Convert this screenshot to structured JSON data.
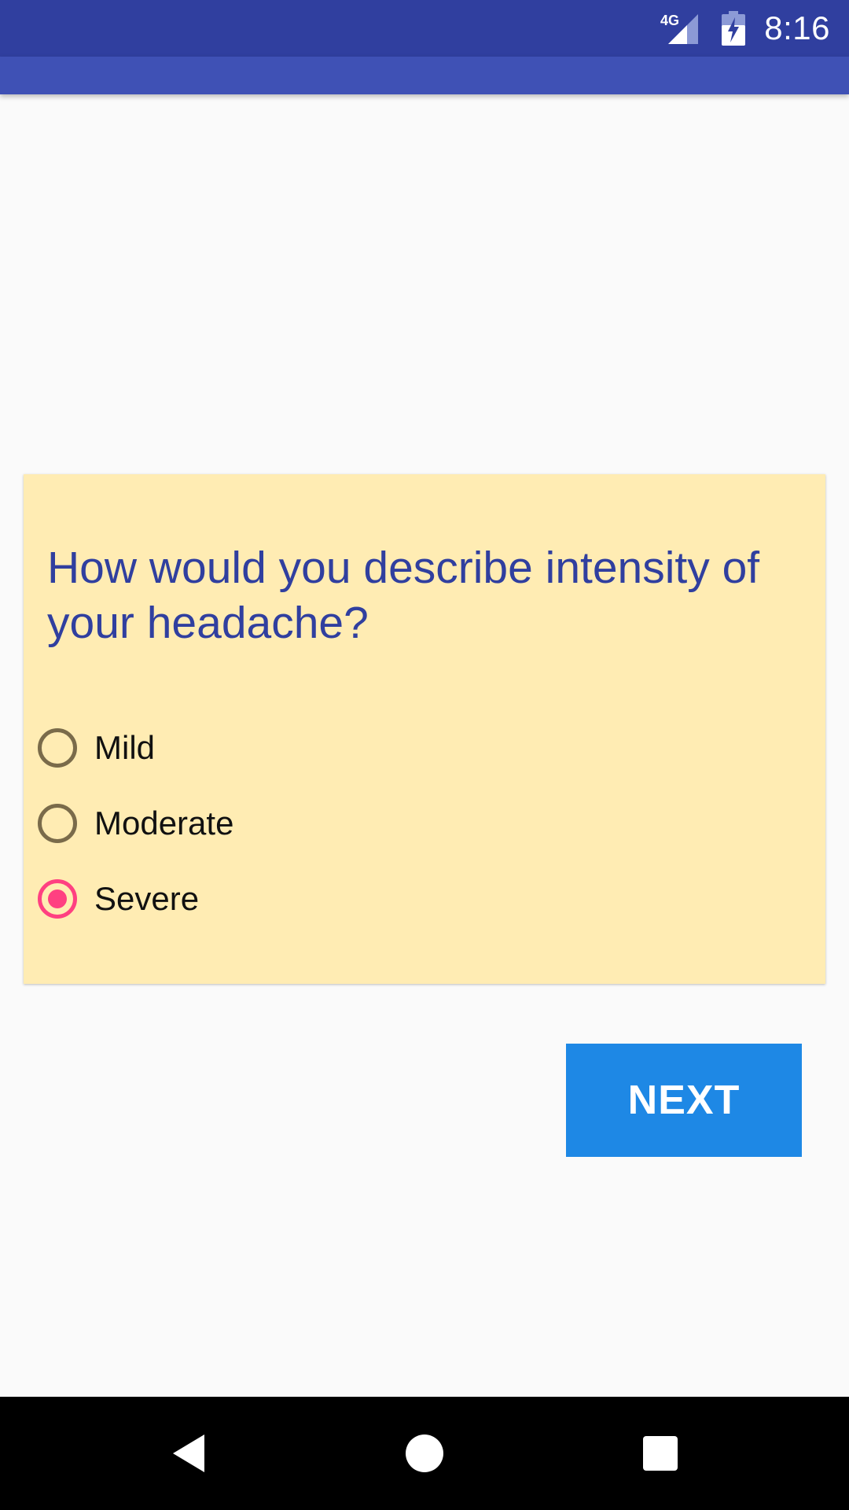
{
  "status_bar": {
    "network_label": "4G",
    "time": "8:16",
    "icons": [
      "signal-icon",
      "battery-charging-icon"
    ]
  },
  "question": {
    "text": "How would you describe intensity of your headache?"
  },
  "options": [
    {
      "label": "Mild",
      "selected": false
    },
    {
      "label": "Moderate",
      "selected": false
    },
    {
      "label": "Severe",
      "selected": true
    }
  ],
  "actions": {
    "next_label": "NEXT"
  },
  "nav": {
    "icons": [
      "back-icon",
      "home-icon",
      "recent-apps-icon"
    ]
  },
  "colors": {
    "status_bar": "#303f9f",
    "app_bar": "#3f51b5",
    "card_background": "#ffecb3",
    "question_text": "#303f9f",
    "radio_selected": "#ff4081",
    "next_button": "#1e88e5"
  }
}
